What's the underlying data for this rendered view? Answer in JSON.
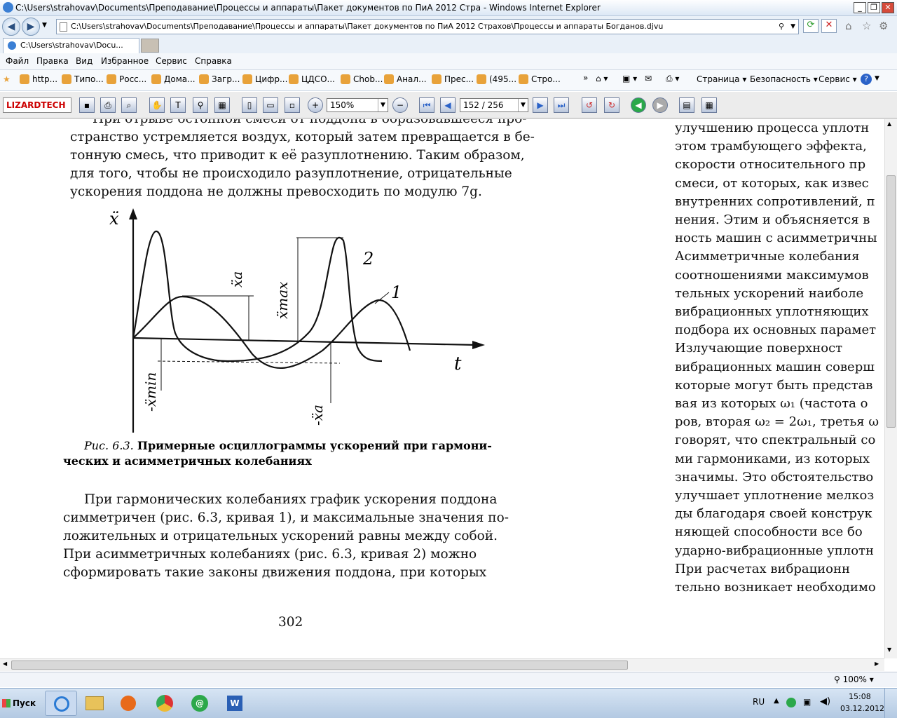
{
  "window": {
    "title": "C:\\Users\\strahovav\\Documents\\Преподавание\\Процессы и аппараты\\Пакет документов по ПиА 2012 Стра - Windows Internet Explorer"
  },
  "address": {
    "url": "C:\\Users\\strahovav\\Documents\\Преподавание\\Процессы и аппараты\\Пакет документов по ПиА 2012 Страхов\\Процессы и аппараты Богданов.djvu"
  },
  "tab": {
    "label": "C:\\Users\\strahovav\\Docu..."
  },
  "menu": [
    "Файл",
    "Правка",
    "Вид",
    "Избранное",
    "Сервис",
    "Справка"
  ],
  "favorites": [
    "http...",
    "Типо...",
    "Росс...",
    "Дома...",
    "Загр...",
    "Цифр...",
    "ЦДСО...",
    "Chob...",
    "Анал...",
    "Прес...",
    "(495...",
    "Стро..."
  ],
  "commands": {
    "page": "Страница",
    "safety": "Безопасность",
    "tools": "Сервис"
  },
  "djvu": {
    "logo": "LIZARDTECH",
    "zoom": "150%",
    "page": "152 / 256"
  },
  "doc": {
    "left_lines": [
      "При отрыве остонной смеси от поддона в образовавшееся про-",
      "странство устремляется воздух, который затем превращается в бе-",
      "тонную смесь, что приводит к её разуплотнению. Таким образом,",
      "для того, чтобы не происходило разуплотнение, отрицательные",
      "ускорения поддона не должны превосходить по модулю 7g."
    ],
    "caption_prefix": "Рис. 6.3.",
    "caption_bold_1": "Примерные осциллограммы ускорений при гармони-",
    "caption_bold_2": "ческих и асимметричных колебаниях",
    "body_lines": [
      "При гармонических колебаниях график ускорения поддона",
      "симметричен (рис. 6.3, кривая 1), и максимальные значения по-",
      "ложительных и отрицательных ускорений равны между собой.",
      "При асимметричных колебаниях (рис. 6.3, кривая 2) можно",
      "сформировать такие законы движения поддона, при которых"
    ],
    "page_number": "302",
    "right_lines": [
      "улучшению процесса уплотн",
      "этом трамбующего эффекта,",
      "скорости относительного пр",
      "смеси, от которых, как извес",
      "внутренних сопротивлений, п",
      "нения. Этим и объясняется в",
      "ность машин с асимметричны",
      "   Асимметричные колебания",
      "соотношениями максимумов",
      "тельных ускорений наиболе",
      "вибрационных уплотняющих",
      "подбора их основных парамет",
      "   Излучающие поверхност",
      "вибрационных машин соверш",
      "которые могут быть представ",
      "вая из которых ω₁ (частота о",
      "ров, вторая ω₂ = 2ω₁, третья ω",
      "говорят, что спектральный со",
      "ми гармониками, из которых",
      "значимы. Это обстоятельство",
      "улучшает уплотнение мелкоз",
      "ды благодаря своей конструк",
      "няющей способности все бо",
      "ударно-вибрационные уплотн",
      "   При расчетах вибрационн",
      "тельно возникает необходимо"
    ],
    "figure": {
      "y_axis": "ẍ",
      "x_axis": "t",
      "curve1": "1",
      "curve2": "2",
      "xa": "ẍa",
      "xmax": "ẍmax",
      "xmin": "-ẍmin",
      "neg_xa": "-ẍa"
    }
  },
  "status": {
    "zoom": "100%"
  },
  "taskbar": {
    "start": "Пуск",
    "lang": "RU",
    "time": "15:08",
    "date": "03.12.2012"
  }
}
